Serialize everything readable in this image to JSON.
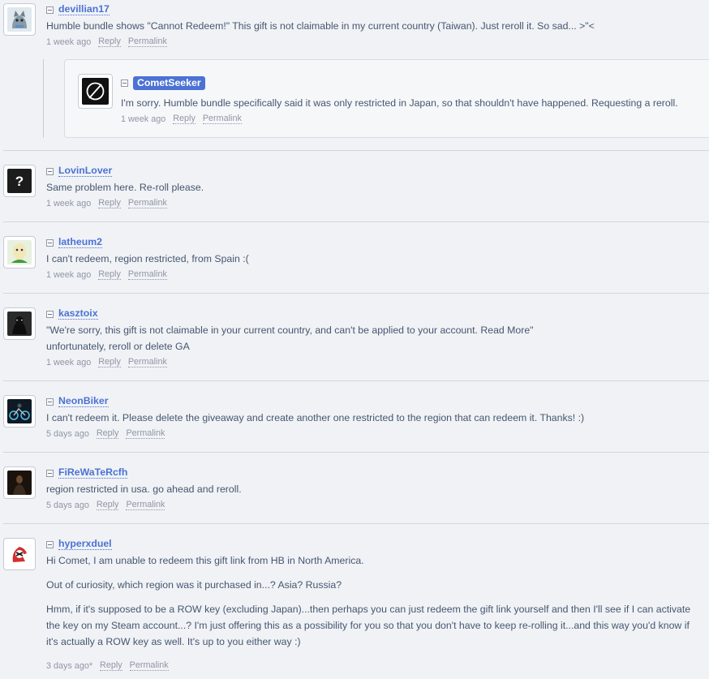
{
  "comments": [
    {
      "username": "devillian17",
      "text": "Humble bundle shows \"Cannot Redeem!\" This gift is not claimable in my current country (Taiwan). Just reroll it. So sad... >\"<",
      "time": "1 week ago",
      "reply_label": "Reply",
      "permalink_label": "Permalink",
      "avatar_icon": "gray-cat-avatar",
      "reply": {
        "username": "CometSeeker",
        "text": "I'm sorry. Humble bundle specifically said it was only restricted in Japan, so that shouldn't have happened. Requesting a reroll.",
        "time": "1 week ago",
        "reply_label": "Reply",
        "permalink_label": "Permalink",
        "avatar_icon": "circle-slash-avatar"
      }
    },
    {
      "username": "LovinLover",
      "text": "Same problem here. Re-roll please.",
      "time": "1 week ago",
      "reply_label": "Reply",
      "permalink_label": "Permalink",
      "avatar_icon": "question-mark-avatar"
    },
    {
      "username": "latheum2",
      "text": "I can't redeem, region restricted, from Spain :(",
      "time": "1 week ago",
      "reply_label": "Reply",
      "permalink_label": "Permalink",
      "avatar_icon": "egg-character-avatar"
    },
    {
      "username": "kasztoix",
      "text": "\"We're sorry, this gift is not claimable in your current country, and can't be applied to your account. Read More\"",
      "text2": "unfortunately, reroll or delete GA",
      "time": "1 week ago",
      "reply_label": "Reply",
      "permalink_label": "Permalink",
      "avatar_icon": "dark-figure-avatar"
    },
    {
      "username": "NeonBiker",
      "text": "I can't redeem it. Please delete the giveaway and create another one restricted to the region that can redeem it. Thanks! :)",
      "time": "5 days ago",
      "reply_label": "Reply",
      "permalink_label": "Permalink",
      "avatar_icon": "neon-bike-avatar"
    },
    {
      "username": "FiReWaTeRcfh",
      "text": "region restricted in usa. go ahead and reroll.",
      "time": "5 days ago",
      "reply_label": "Reply",
      "permalink_label": "Permalink",
      "avatar_icon": "dark-portrait-avatar"
    },
    {
      "username": "hyperxduel",
      "paragraphs": [
        "Hi Comet, I am unable to redeem this gift link from HB in North America.",
        "Out of curiosity, which region was it purchased in...? Asia? Russia?",
        "Hmm, if it's supposed to be a ROW key (excluding Japan)...then perhaps you can just redeem the gift link yourself and then I'll see if I can activate the key on my Steam account...? I'm just offering this as a possibility for you so that you don't have to keep re-rolling it...and this way you'd know if it's actually a ROW key as well. It's up to you either way :)"
      ],
      "time": "3 days ago*",
      "reply_label": "Reply",
      "permalink_label": "Permalink",
      "avatar_icon": "hyperx-logo-avatar"
    }
  ]
}
